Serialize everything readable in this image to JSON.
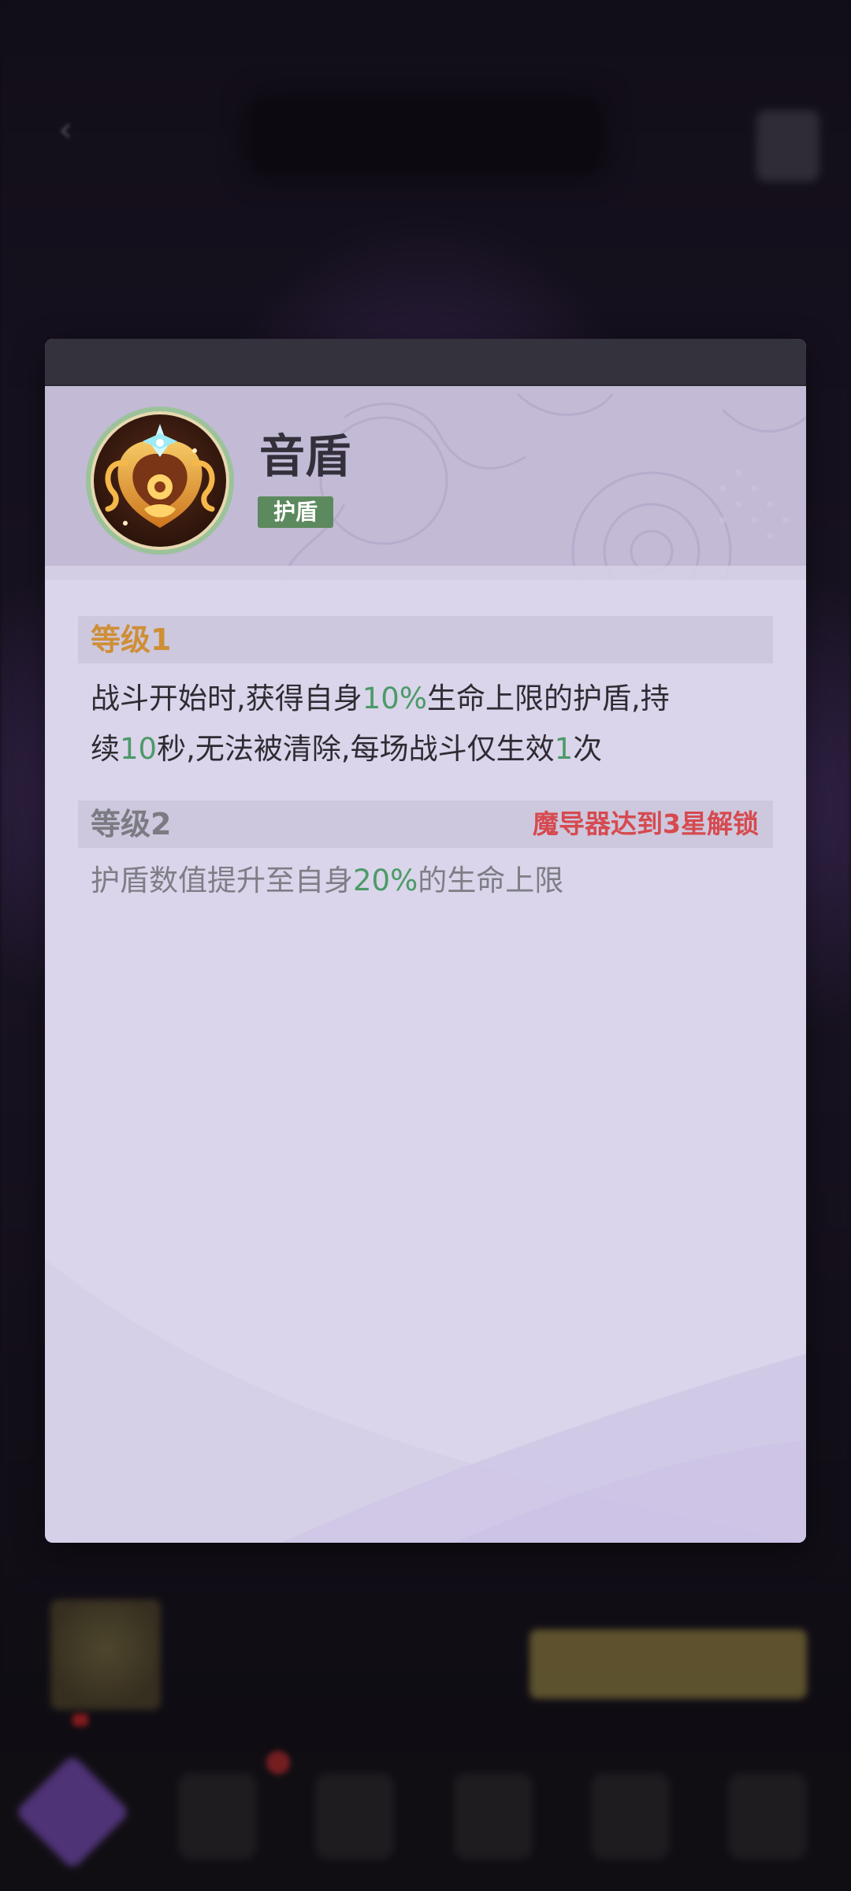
{
  "modal": {
    "skill_name": "音盾",
    "skill_tag": "护盾",
    "levels": [
      {
        "title": "等级1",
        "desc_parts": [
          "战斗开始时,获得自身",
          "10%",
          "生命上限的护盾,持",
          "续",
          "10",
          "秒,无法被清除,每场战斗仅生效",
          "1",
          "次"
        ]
      },
      {
        "title": "等级2",
        "lock_note": "魔导器达到3星解锁",
        "desc_parts": [
          "护盾数值提升至自身",
          "20%",
          "的生命上限"
        ]
      }
    ]
  },
  "colors": {
    "accent_gold": "#cf8f37",
    "highlight_green": "#4c9a68",
    "locked_red": "#d64a4f",
    "tag_green": "#5c8a5e"
  },
  "icons": {
    "skill": "shield-sound-emblem-icon"
  }
}
